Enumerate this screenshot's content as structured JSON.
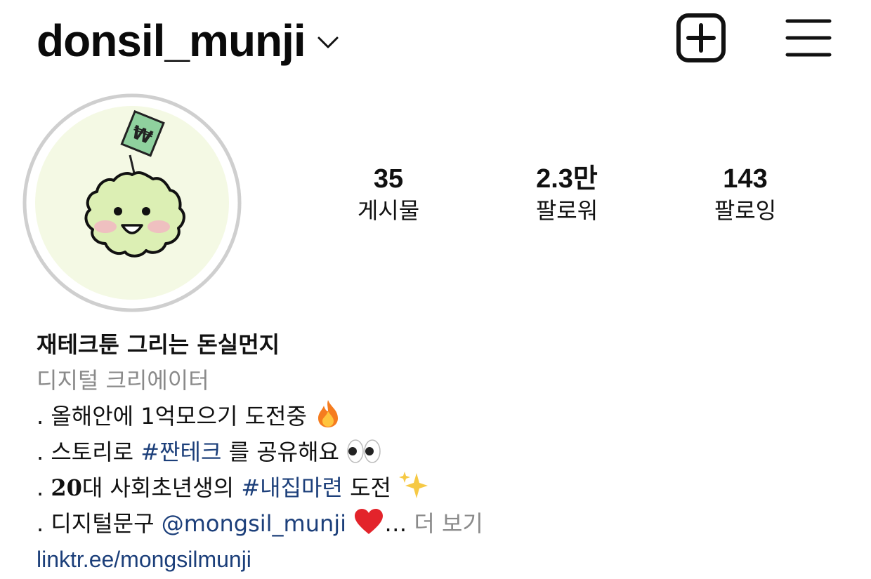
{
  "header": {
    "username": "donsil_munji",
    "chevron_icon": "chevron-down-icon",
    "add_icon": "plus-square-icon",
    "menu_icon": "hamburger-menu-icon"
  },
  "stats": [
    {
      "value": "35",
      "label": "게시물"
    },
    {
      "value": "2.3만",
      "label": "팔로워"
    },
    {
      "value": "143",
      "label": "팔로잉"
    }
  ],
  "bio": {
    "name": "재테크툰 그리는 돈실먼지",
    "category": "디지털 크리에이터",
    "line1": ". 올해안에 1억모으기 도전중",
    "line1_emoji": "fire-icon",
    "line2_prefix": ". 스토리로 ",
    "line2_tag": "#짠테크",
    "line2_suffix": " 를 공유해요",
    "line2_emoji": "eyes-icon",
    "line3_prefix": ". ",
    "line3_bold": "20",
    "line3_mid": "대 사회초년생의 ",
    "line3_tag": "#내집마련",
    "line3_suffix": " 도전",
    "line3_emoji": "sparkles-icon",
    "line4_prefix": ". 디지털문구 ",
    "line4_mention": "@mongsil_munji",
    "line4_emoji": "red-heart-icon",
    "line4_ellipsis": "… ",
    "more_label": "더 보기",
    "link": "linktr.ee/mongsilmunji"
  },
  "colors": {
    "link": "#1c3f7a",
    "muted": "#8a8a8a",
    "avatar_bg": "#f4f9e4",
    "avatar_ring": "#cfcfcf"
  }
}
